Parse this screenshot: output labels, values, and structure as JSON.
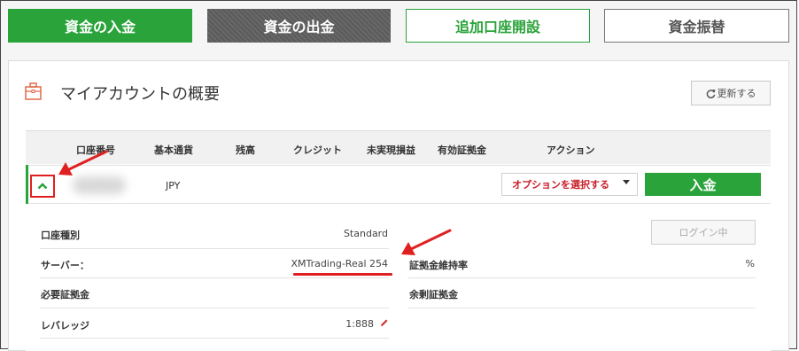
{
  "top_buttons": {
    "deposit": "資金の入金",
    "withdraw": "資金の出金",
    "open_account": "追加口座開設",
    "transfer": "資金振替"
  },
  "panel": {
    "title": "マイアカウントの概要",
    "refresh_label": "更新する"
  },
  "table": {
    "headers": [
      "口座番号",
      "基本通貨",
      "残高",
      "クレジット",
      "未実現損益",
      "有効証拠金",
      "アクション"
    ],
    "row": {
      "currency": "JPY",
      "option_select": "オプションを選択する",
      "deposit_button": "入金"
    }
  },
  "details": {
    "account_type_label": "口座種別",
    "account_type_value": "Standard",
    "server_label": "サーバー：",
    "server_value": "XMTrading-Real 254",
    "required_margin_label": "必要証拠金",
    "leverage_label": "レバレッジ",
    "leverage_value": "1:888",
    "margin_level_label": "証拠金維持率",
    "margin_level_unit": "%",
    "free_margin_label": "余剰証拠金",
    "login_button": "ログイン中"
  },
  "colors": {
    "green": "#2aa33a",
    "red_annotation": "#e02020",
    "dark_button": "#5b5b5b"
  },
  "icons": [
    "briefcase-icon",
    "refresh-icon",
    "chevron-up-icon",
    "caret-down-icon",
    "pencil-icon"
  ]
}
